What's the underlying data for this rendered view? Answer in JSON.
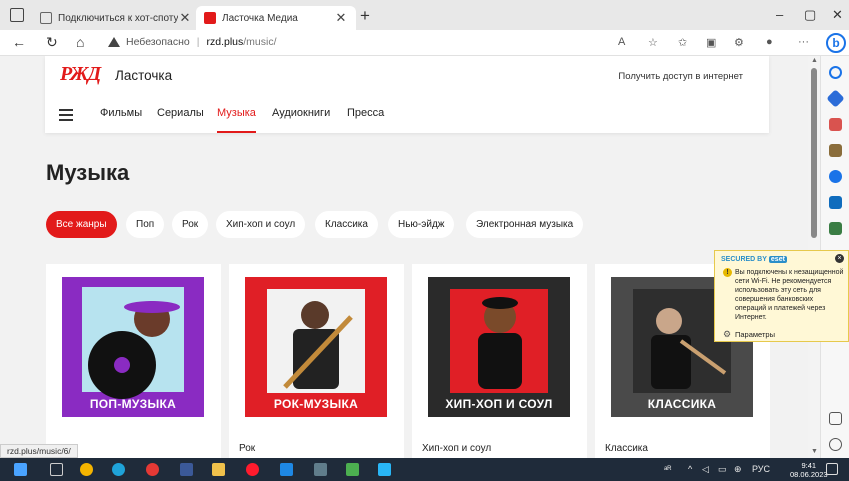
{
  "browser": {
    "tabs": [
      {
        "title": "Подключиться к хот-споту Wi-Fi",
        "active": false
      },
      {
        "title": "Ласточка Медиа",
        "active": true
      }
    ],
    "new_tab": "+",
    "window_buttons": {
      "minimize": "–",
      "maximize": "▢",
      "close": "✕"
    },
    "nav": {
      "back": "←",
      "refresh": "↻",
      "home": "⌂"
    },
    "address": {
      "security_label": "Небезопасно",
      "separator": "|",
      "host": "rzd.plus",
      "path": "/music/"
    },
    "toolbar_more": "···",
    "status_url": "rzd.plus/music/6/"
  },
  "site": {
    "logo_text": "РЖД",
    "brand": "Ласточка",
    "get_access": "Получить доступ в интернет",
    "nav": [
      "Фильмы",
      "Сериалы",
      "Музыка",
      "Аудиокниги",
      "Пресса"
    ],
    "nav_active": "Музыка",
    "page_title": "Музыка",
    "genres": [
      "Все жанры",
      "Поп",
      "Рок",
      "Хип-хоп и соул",
      "Классика",
      "Нью-эйдж",
      "Электронная музыка"
    ],
    "genre_active": "Все жанры",
    "cards": [
      {
        "cover_label": "ПОП-МУЗЫКА",
        "title": "",
        "color": "#8a2bc2"
      },
      {
        "cover_label": "РОК-МУЗЫКА",
        "title": "Рок",
        "color": "#e01f26"
      },
      {
        "cover_label": "ХИП-ХОП И СОУЛ",
        "title": "Хип-хоп и соул",
        "color": "#2a2a2a"
      },
      {
        "cover_label": "КЛАССИКА",
        "title": "Классика",
        "color": "#4a4a4a"
      }
    ]
  },
  "eset": {
    "header": "SECURED BY",
    "logo": "eset",
    "close": "×",
    "warn_glyph": "!",
    "message": "Вы подключены к незащищенной сети Wi-Fi. Не рекомендуется использовать эту сеть для совершения банковских операций и платежей через Интернет.",
    "settings": "Параметры"
  },
  "taskbar": {
    "lang": "РУС",
    "time": "9:41",
    "date": "08.06.2023"
  },
  "colors": {
    "accent": "#e21a1a"
  }
}
